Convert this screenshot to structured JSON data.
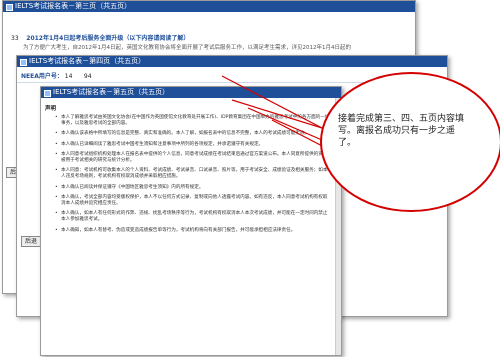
{
  "window1": {
    "title": "IELTS考试报名表－第三页（共五页）",
    "row_number": "33",
    "row_text": "2012年1月4日起考后服务全面升级（以下内容请阅读了解）",
    "row_text2": "为了方便广大考生，自2012年1月4日起，英国文化教育协会将全面开展了考试后服务工作，以满足考生需求，详见2012年1月4日起的",
    "back_button": "后退"
  },
  "window2": {
    "title": "IELTS考试报名表－第四页（共五页）",
    "user_label": "NEEA用户号：",
    "user_part1": "14",
    "user_part2": "94",
    "back_button": "后退"
  },
  "window3": {
    "title": "IELTS考试报名表－第五页（共五页）",
    "section_title": "声明",
    "paragraphs": [
      "本人了解雅思考试由英国文化协会(在中国作为英国使馆文化教育处开展工作)、IDP教育集团在中国举办的雅思考试中的各方面的一切事务，以及雅思考试的全部内容。",
      "本人确认该表格中所填写的信息是完整、真实和准确的。本人了解，如报名表中的信息不完整，本人的考试成绩可能无效。",
      "本人确认已详细阅读了雅思考试中国考生须知和注意事项中所列的各项规定，并承诺遵守有关规定。",
      "本人同意考试组织机构处理本人在报名表中提供的个人信息，同意考试成绩在考试结束后通过官方渠道公布。本人同意所提供的资料被用于考试相关的研究与统计分析。",
      "本人同意：考试机构可收集本人的个人资料、考试成绩、考试录音、口试录音、照片等，用于考试安全、成绩验证及相关服务；如本人违反考场规则，考试机构有权取消成绩并采取相应措施。",
      "本人确认已阅读并保证遵守《中国地区雅思考生须知》内的所有规定。",
      "本人确认，考试全部内容均受版权保护，本人不以任何方式记录、复制或向他人透露考试内容。如有违反，本人同意考试机构有权取消本人成绩并追究相应责任。",
      "本人确认，如本人有任何形式的作弊、违规、扰乱考场秩序等行为，考试机构有权取消本人本次考试成绩，并可能在一定时间内禁止本人参加雅思考试。",
      "本人确知，如本人有替考、伪造或变造成绩报告单等行为，考试机构将向有关部门报告，并可能承担相应法律责任。"
    ]
  },
  "callout": {
    "text": "接着完成第三、四、五页内容填写。离报名成功只有一步之遥了。"
  },
  "colors": {
    "titlebar": "#1f4f99",
    "callout_border": "#d40000"
  }
}
